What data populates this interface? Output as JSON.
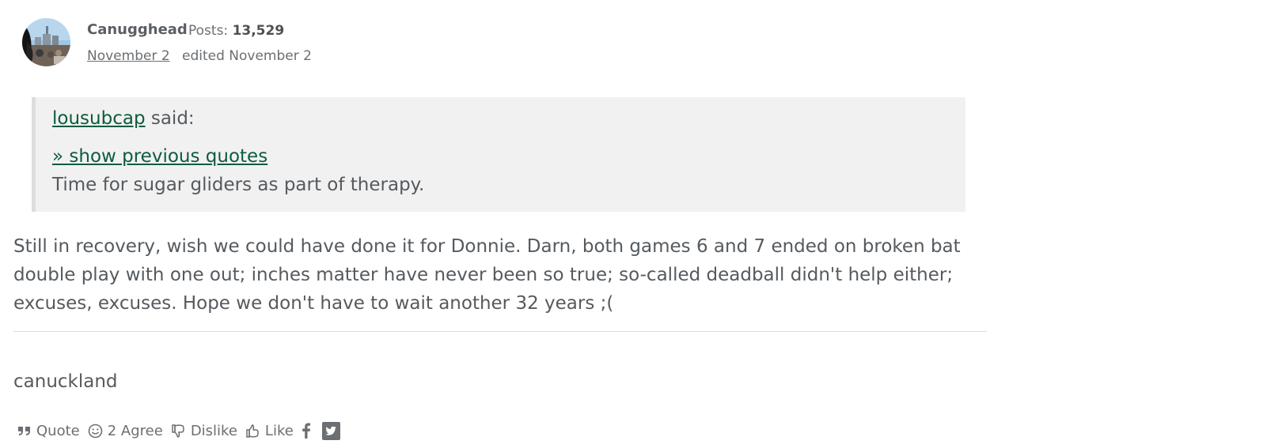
{
  "author": {
    "name": "Canugghead",
    "posts_label": "Posts:",
    "posts_count": "13,529",
    "date": "November 2",
    "edited": "edited November 2"
  },
  "quote": {
    "author": "lousubcap",
    "said": " said:",
    "show_previous": "» show previous quotes",
    "text": "Time for sugar gliders as part of therapy."
  },
  "post": {
    "body": "Still in recovery, wish we could have done it for Donnie. Darn, both games 6 and 7 ended on broken bat double play with one out; inches matter have never been so true; so-called deadball didn't help either; excuses, excuses. Hope we don't have to wait another 32 years ;(",
    "signature": "canuckland"
  },
  "actions": {
    "quote": "Quote",
    "agree": "2 Agree",
    "dislike": "Dislike",
    "like": "Like"
  },
  "colors": {
    "link": "#0d5c3e",
    "text": "#555a5f",
    "quote_bg": "#f1f1f1"
  }
}
